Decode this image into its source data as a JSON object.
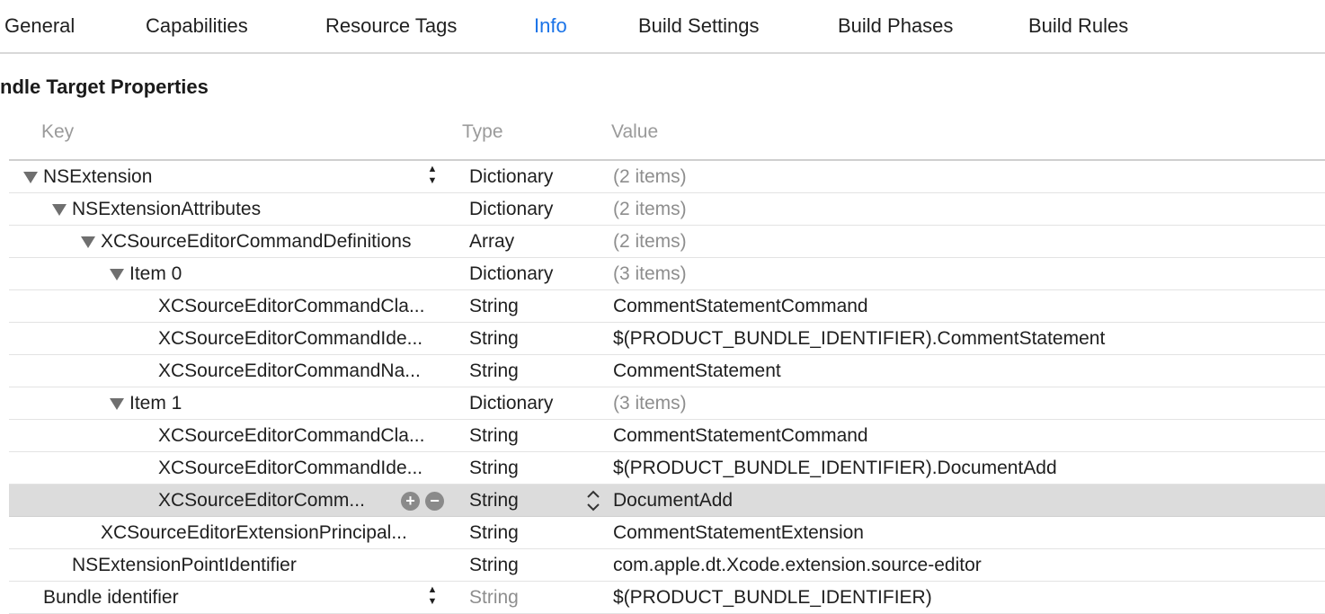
{
  "tabs": [
    {
      "label": "General",
      "active": false
    },
    {
      "label": "Capabilities",
      "active": false
    },
    {
      "label": "Resource Tags",
      "active": false
    },
    {
      "label": "Info",
      "active": true
    },
    {
      "label": "Build Settings",
      "active": false
    },
    {
      "label": "Build Phases",
      "active": false
    },
    {
      "label": "Build Rules",
      "active": false
    }
  ],
  "section_title": "ndle Target Properties",
  "columns": {
    "key": "Key",
    "type": "Type",
    "value": "Value"
  },
  "rows": [
    {
      "key": "NSExtension",
      "type": "Dictionary",
      "value": "(2 items)"
    },
    {
      "key": "NSExtensionAttributes",
      "type": "Dictionary",
      "value": "(2 items)"
    },
    {
      "key": "XCSourceEditorCommandDefinitions",
      "type": "Array",
      "value": "(2 items)"
    },
    {
      "key": "Item 0",
      "type": "Dictionary",
      "value": "(3 items)"
    },
    {
      "key": "XCSourceEditorCommandCla...",
      "type": "String",
      "value": "CommentStatementCommand"
    },
    {
      "key": "XCSourceEditorCommandIde...",
      "type": "String",
      "value": "$(PRODUCT_BUNDLE_IDENTIFIER).CommentStatement"
    },
    {
      "key": "XCSourceEditorCommandNa...",
      "type": "String",
      "value": "CommentStatement"
    },
    {
      "key": "Item 1",
      "type": "Dictionary",
      "value": "(3 items)"
    },
    {
      "key": "XCSourceEditorCommandCla...",
      "type": "String",
      "value": "CommentStatementCommand"
    },
    {
      "key": "XCSourceEditorCommandIde...",
      "type": "String",
      "value": "$(PRODUCT_BUNDLE_IDENTIFIER).DocumentAdd"
    },
    {
      "key": "XCSourceEditorComm...",
      "type": "String",
      "value": "DocumentAdd"
    },
    {
      "key": "XCSourceEditorExtensionPrincipal...",
      "type": "String",
      "value": "CommentStatementExtension"
    },
    {
      "key": "NSExtensionPointIdentifier",
      "type": "String",
      "value": "com.apple.dt.Xcode.extension.source-editor"
    },
    {
      "key": "Bundle identifier",
      "type": "String",
      "value": "$(PRODUCT_BUNDLE_IDENTIFIER)"
    }
  ],
  "selected_row": 10,
  "colors": {
    "accent": "#1a73e8",
    "selected_row": "#dcdcdc",
    "muted_text": "#8e8e8e"
  },
  "icons": [
    "disclosure-triangle-icon",
    "sort-stepper-icon",
    "add-icon",
    "remove-icon",
    "chevron-up-down-icon"
  ]
}
